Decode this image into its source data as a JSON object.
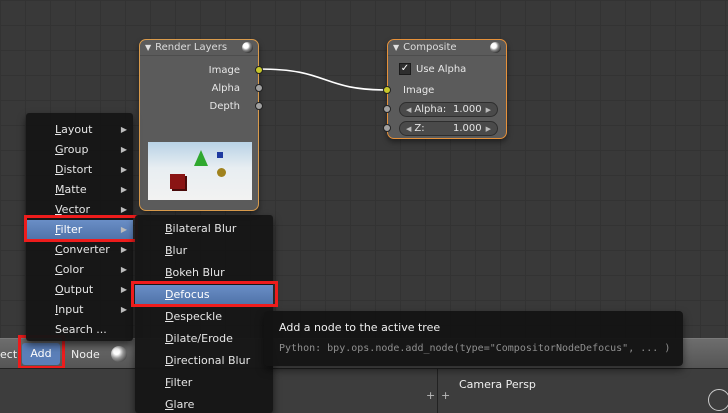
{
  "render_layers_node": {
    "title": "Render Layers",
    "outputs": [
      "Image",
      "Alpha",
      "Depth"
    ]
  },
  "composite_node": {
    "title": "Composite",
    "use_alpha_label": "Use Alpha",
    "use_alpha_checked": true,
    "input_label": "Image",
    "alpha_field": {
      "label": "Alpha:",
      "value": "1.000"
    },
    "z_field": {
      "label": "Z:",
      "value": "1.000"
    }
  },
  "add_menu": {
    "items": [
      {
        "label": "Layout",
        "underline": "L",
        "rest": "ayout"
      },
      {
        "label": "Group",
        "underline": "G",
        "rest": "roup"
      },
      {
        "label": "Distort",
        "underline": "D",
        "rest": "istort"
      },
      {
        "label": "Matte",
        "underline": "M",
        "rest": "atte"
      },
      {
        "label": "Vector",
        "underline": "V",
        "rest": "ector"
      },
      {
        "label": "Filter",
        "underline": "F",
        "rest": "ilter"
      },
      {
        "label": "Converter",
        "underline": "C",
        "rest": "onverter"
      },
      {
        "label": "Color",
        "underline": "C",
        "rest": "olor"
      },
      {
        "label": "Output",
        "underline": "O",
        "rest": "utput"
      },
      {
        "label": "Input",
        "underline": "I",
        "rest": "nput"
      },
      {
        "label": "Search ...",
        "underline": "",
        "rest": "Search ..."
      }
    ],
    "highlighted": "Filter"
  },
  "filter_menu": {
    "items": [
      {
        "underline": "B",
        "rest": "ilateral Blur"
      },
      {
        "underline": "B",
        "rest": "lur"
      },
      {
        "underline": "B",
        "rest": "okeh Blur"
      },
      {
        "underline": "D",
        "rest": "efocus"
      },
      {
        "underline": "D",
        "rest": "especkle"
      },
      {
        "underline": "D",
        "rest": "ilate/Erode"
      },
      {
        "underline": "D",
        "rest": "irectional Blur"
      },
      {
        "underline": "F",
        "rest": "ilter"
      },
      {
        "underline": "G",
        "rest": "lare"
      }
    ],
    "highlighted": "Defocus"
  },
  "tooltip": {
    "description": "Add a node to the active tree",
    "python": "Python: bpy.ops.node.add_node(type=\"CompositorNodeDefocus\", ... )"
  },
  "header": {
    "select_partial": "ect",
    "add_label": "Add",
    "node_label": "Node"
  },
  "viewport": {
    "camera_label": "Camera Persp"
  },
  "colors": {
    "highlight_blue": "#5b7fb8",
    "annotation_red": "#ee1c1c",
    "node_border_active": "#e6913a",
    "link_yellow": "#c7c729"
  }
}
